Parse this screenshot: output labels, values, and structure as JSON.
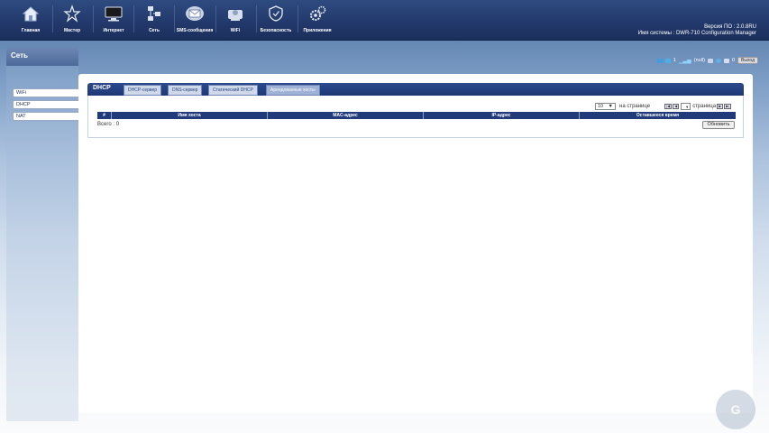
{
  "nav": [
    {
      "label": "Главная",
      "icon": "home-icon"
    },
    {
      "label": "Мастер",
      "icon": "wizard-icon"
    },
    {
      "label": "Интернет",
      "icon": "monitor-icon"
    },
    {
      "label": "Сеть",
      "icon": "network-icon"
    },
    {
      "label": "SMS-сообщения",
      "icon": "envelope-icon"
    },
    {
      "label": "WiFi",
      "icon": "wifi-icon"
    },
    {
      "label": "Безопасность",
      "icon": "shield-icon"
    },
    {
      "label": "Приложения",
      "icon": "gears-icon"
    }
  ],
  "firmware": {
    "version_line": "Версия ПО : 2.0.8RU",
    "system_line": "Имя системы : DWR-710 Configuration Manager"
  },
  "sidebar": {
    "title": "Сеть",
    "items": [
      "WiFi",
      "DHCP",
      "NAT"
    ]
  },
  "status": {
    "sms_count": "1",
    "signal_text": "(null)",
    "count_zero": "0",
    "logout_label": "Выход"
  },
  "dhcp": {
    "title": "DHCP",
    "tabs": [
      "DHCP-сервер",
      "DNS-сервер",
      "Статический DHCP",
      "Арендованные хосты"
    ],
    "active_tab": 3,
    "per_page_value": "10",
    "per_page_label": "на странице",
    "page_label": "страница",
    "columns": [
      "#",
      "Имя хоста",
      "MAC-адрес",
      "IP-адрес",
      "Оставшееся время"
    ],
    "total_label": "Всего : 0",
    "refresh_label": "Обновить"
  },
  "colors": {
    "header_bg": "#22386a",
    "accent": "#203a7a"
  }
}
